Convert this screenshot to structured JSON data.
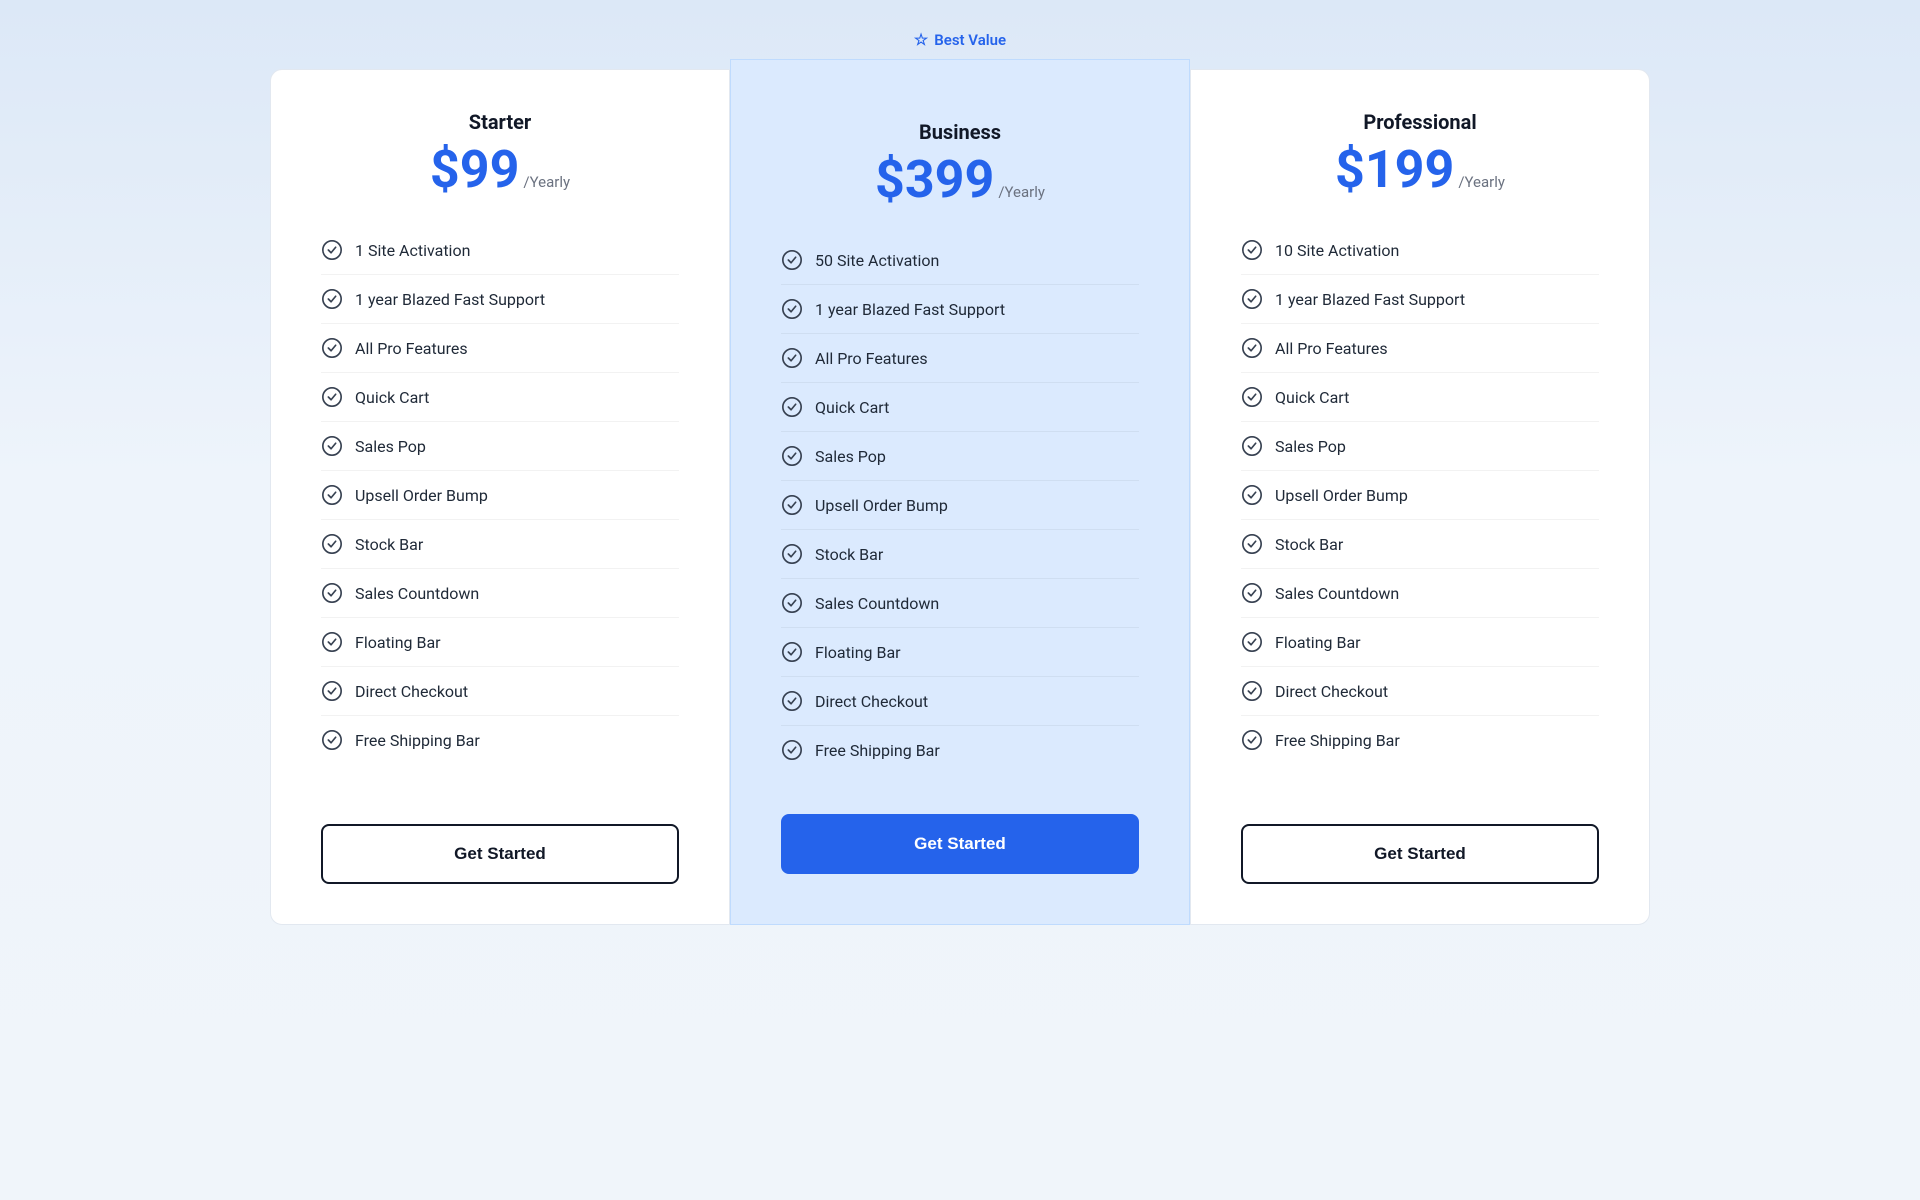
{
  "bestValue": {
    "label": "Best Value",
    "starIcon": "★"
  },
  "plans": [
    {
      "id": "starter",
      "name": "Starter",
      "price": "$99",
      "period": "/Yearly",
      "buttonLabel": "Get Started",
      "buttonStyle": "outline",
      "features": [
        "1 Site Activation",
        "1 year Blazed Fast Support",
        "All Pro Features",
        "Quick Cart",
        "Sales Pop",
        "Upsell Order Bump",
        "Stock Bar",
        "Sales Countdown",
        "Floating Bar",
        "Direct Checkout",
        "Free Shipping Bar"
      ]
    },
    {
      "id": "business",
      "name": "Business",
      "price": "$399",
      "period": "/Yearly",
      "buttonLabel": "Get Started",
      "buttonStyle": "primary",
      "features": [
        "50 Site Activation",
        "1 year Blazed Fast Support",
        "All Pro Features",
        "Quick Cart",
        "Sales Pop",
        "Upsell Order Bump",
        "Stock Bar",
        "Sales Countdown",
        "Floating Bar",
        "Direct Checkout",
        "Free Shipping Bar"
      ]
    },
    {
      "id": "professional",
      "name": "Professional",
      "price": "$199",
      "period": "/Yearly",
      "buttonLabel": "Get Started",
      "buttonStyle": "outline",
      "features": [
        "10 Site Activation",
        "1 year Blazed Fast Support",
        "All Pro Features",
        "Quick Cart",
        "Sales Pop",
        "Upsell Order Bump",
        "Stock Bar",
        "Sales Countdown",
        "Floating Bar",
        "Direct Checkout",
        "Free Shipping Bar"
      ]
    }
  ]
}
